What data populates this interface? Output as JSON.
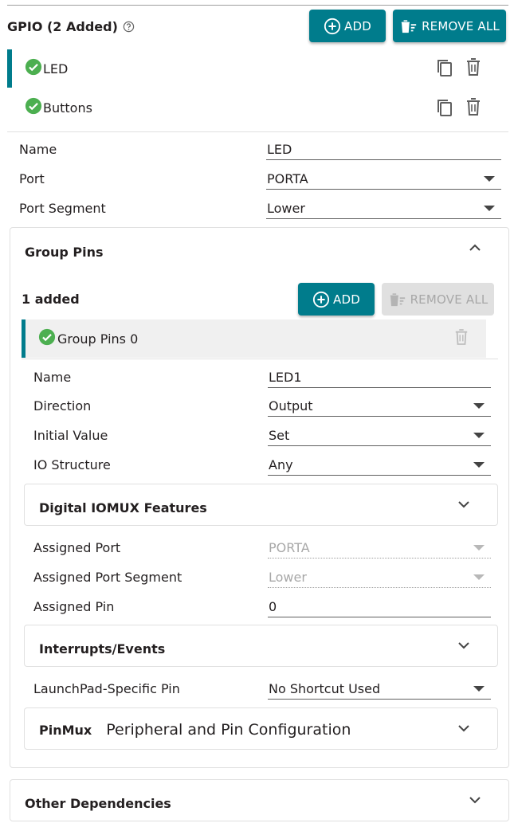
{
  "header": {
    "title": "GPIO (2 Added)",
    "add_label": "ADD",
    "remove_all_label": "REMOVE ALL"
  },
  "instances": [
    {
      "label": "LED",
      "selected": true
    },
    {
      "label": "Buttons",
      "selected": false
    }
  ],
  "form": {
    "name_label": "Name",
    "name_value": "LED",
    "port_label": "Port",
    "port_value": "PORTA",
    "segment_label": "Port Segment",
    "segment_value": "Lower"
  },
  "group_pins": {
    "title": "Group Pins",
    "count_label": "1 added",
    "add_label": "ADD",
    "remove_all_label": "REMOVE ALL",
    "item_label": "Group Pins 0",
    "name_label": "Name",
    "name_value": "LED1",
    "direction_label": "Direction",
    "direction_value": "Output",
    "initial_label": "Initial Value",
    "initial_value": "Set",
    "io_label": "IO Structure",
    "io_value": "Any",
    "iomux_title": "Digital IOMUX Features",
    "assigned_port_label": "Assigned Port",
    "assigned_port_value": "PORTA",
    "assigned_segment_label": "Assigned Port Segment",
    "assigned_segment_value": "Lower",
    "assigned_pin_label": "Assigned Pin",
    "assigned_pin_value": "0",
    "interrupts_title": "Interrupts/Events",
    "launchpad_label": "LaunchPad-Specific Pin",
    "launchpad_value": "No Shortcut Used",
    "pinmux_title": "PinMux",
    "pinmux_subtitle": "Peripheral and Pin Configuration"
  },
  "other": {
    "title": "Other Dependencies"
  },
  "colors": {
    "accent": "#007c8c",
    "success": "#4caf50",
    "disabled": "#e0e0e0"
  },
  "icons": [
    "help-icon",
    "add-circle-icon",
    "delete-sweep-icon",
    "check-circle-icon",
    "copy-icon",
    "trash-icon",
    "chevron-up-icon",
    "chevron-down-icon"
  ]
}
